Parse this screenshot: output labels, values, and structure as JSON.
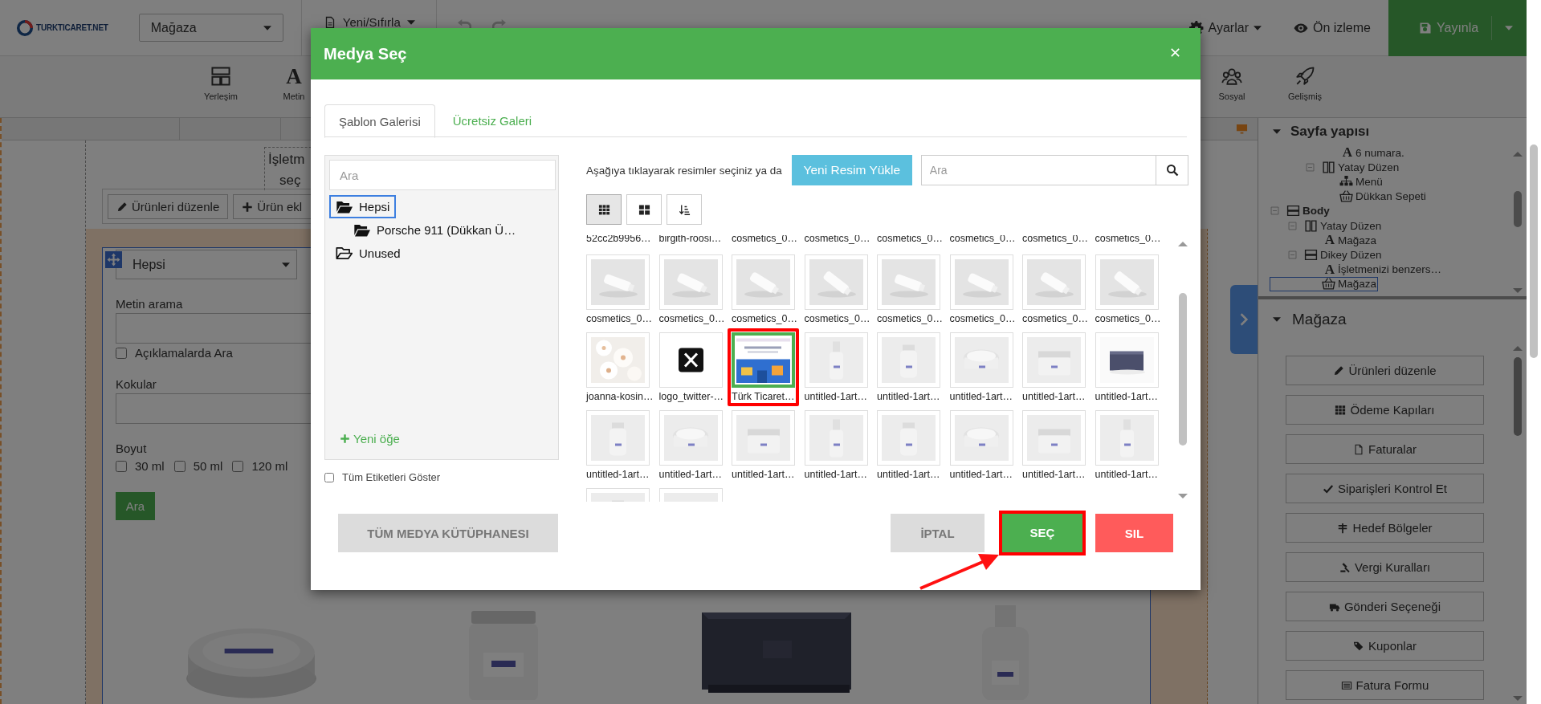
{
  "topbar": {
    "logo_text": "TURKTICARET.NET",
    "page_select": "Mağaza",
    "file_menu": "Yeni/Sıfırla",
    "settings": "Ayarlar",
    "preview": "Ön izleme",
    "publish": "Yayınla"
  },
  "toolbar": {
    "left": [
      {
        "label": "Yerleşim",
        "kind": "layout"
      },
      {
        "label": "Metin",
        "kind": "text",
        "glyph": "A"
      }
    ],
    "right": [
      {
        "label": "Sosyal",
        "kind": "social"
      },
      {
        "label": "Gelişmiş",
        "kind": "advanced"
      }
    ]
  },
  "store_widget": {
    "heading_lines": [
      "İşletm",
      "seç"
    ],
    "actions": [
      {
        "label": "Ürünleri düzenle",
        "kind": "pencil"
      },
      {
        "label": "Ürün ekl",
        "kind": "plus"
      }
    ],
    "category_select": "Hepsi",
    "text_search": {
      "label": "Metin arama",
      "checkbox": {
        "label": "Açıklamalarda Ara",
        "checked": false
      }
    },
    "scents": {
      "label": "Kokular"
    },
    "size": {
      "label": "Boyut",
      "options": [
        {
          "label": "30 ml",
          "checked": false
        },
        {
          "label": "50 ml",
          "checked": false
        },
        {
          "label": "120 ml",
          "checked": false
        }
      ]
    },
    "search_button": "Ara"
  },
  "side_panel": {
    "structure_title": "Sayfa yapısı",
    "tree": [
      {
        "children": [
          {
            "children": [
              {
                "children": [
                  {
                    "kind": "text",
                    "glyph": "A",
                    "label": "6 numara.",
                    "selected": false
                  }
                ]
              },
              {
                "kind": "columns",
                "label": "Yatay Düzen",
                "expanded": true,
                "selected": false,
                "children": [
                  {
                    "kind": "sitemap",
                    "label": "Menü",
                    "selected": false
                  },
                  {
                    "kind": "basket",
                    "label": "Dükkan Sepeti",
                    "selected": false
                  }
                ]
              }
            ]
          }
        ]
      },
      {
        "kind": "section",
        "label": "Body",
        "expanded": true,
        "selected": false,
        "children": [
          {
            "kind": "columns",
            "label": "Yatay Düzen",
            "expanded": true,
            "selected": false,
            "children": [
              {
                "kind": "text",
                "glyph": "A",
                "label": "Mağaza",
                "selected": false
              }
            ]
          },
          {
            "kind": "rows",
            "label": "Dikey Düzen",
            "expanded": true,
            "selected": false,
            "children": [
              {
                "kind": "text",
                "glyph": "A",
                "label": "İşletmenizi benzers…",
                "selected": false
              },
              {
                "kind": "basket",
                "label": "Mağaza",
                "selected": true
              }
            ]
          }
        ]
      }
    ],
    "section_title": "Mağaza",
    "buttons": [
      {
        "label": "Ürünleri düzenle",
        "kind": "pencil"
      },
      {
        "label": "Ödeme Kapıları",
        "kind": "th"
      },
      {
        "label": "Faturalar",
        "kind": "file"
      },
      {
        "label": "Siparişleri Kontrol Et",
        "kind": "check"
      },
      {
        "label": "Hedef Bölgeler",
        "kind": "signpost"
      },
      {
        "label": "Vergi Kuralları",
        "kind": "gavel"
      },
      {
        "label": "Gönderi Seçeneği",
        "kind": "truck"
      },
      {
        "label": "Kuponlar",
        "kind": "tags"
      },
      {
        "label": "Fatura Formu",
        "kind": "listalt"
      }
    ]
  },
  "media_dialog": {
    "title": "Medya Seç",
    "tabs": [
      {
        "label": "Şablon Galerisi",
        "selected": true
      },
      {
        "label": "Ücretsiz Galeri",
        "selected": false
      }
    ],
    "folder_search": {
      "placeholder": "Ara"
    },
    "folders": [
      {
        "label": "Hepsi",
        "selected": true,
        "empty": false,
        "children": [
          {
            "label": "Porsche 911 (Dükkan Ü…",
            "selected": false,
            "empty": false
          }
        ]
      },
      {
        "label": "Unused",
        "selected": false,
        "empty": true
      }
    ],
    "new_item": "Yeni öğe",
    "show_tags": {
      "label": "Tüm Etiketleri Göster",
      "checked": false
    },
    "hint": "Aşağıya tıklayarak resimler seçiniz ya da",
    "upload_button": "Yeni Resim Yükle",
    "search": {
      "placeholder": "Ara"
    },
    "view_buttons": [
      {
        "kind": "small-grid",
        "selected": true
      },
      {
        "kind": "large-grid",
        "selected": false
      },
      {
        "kind": "sort",
        "selected": false
      }
    ],
    "items": [
      {
        "label": "52cc2b9956…",
        "kind": "product",
        "selected": false
      },
      {
        "label": "birgith-roosi…",
        "kind": "product",
        "selected": false
      },
      {
        "label": "cosmetics_0…",
        "kind": "product",
        "selected": false
      },
      {
        "label": "cosmetics_0…",
        "kind": "product",
        "selected": false
      },
      {
        "label": "cosmetics_0…",
        "kind": "product",
        "selected": false
      },
      {
        "label": "cosmetics_0…",
        "kind": "product",
        "selected": false
      },
      {
        "label": "cosmetics_0…",
        "kind": "product",
        "selected": false
      },
      {
        "label": "cosmetics_0…",
        "kind": "product",
        "selected": false
      },
      {
        "label": "cosmetics_0…",
        "kind": "product",
        "selected": false
      },
      {
        "label": "cosmetics_0…",
        "kind": "product",
        "selected": false
      },
      {
        "label": "cosmetics_0…",
        "kind": "product",
        "selected": false
      },
      {
        "label": "cosmetics_0…",
        "kind": "product",
        "selected": false
      },
      {
        "label": "cosmetics_0…",
        "kind": "product",
        "selected": false
      },
      {
        "label": "cosmetics_0…",
        "kind": "product",
        "selected": false
      },
      {
        "label": "cosmetics_0…",
        "kind": "product",
        "selected": false
      },
      {
        "label": "cosmetics_0…",
        "kind": "product",
        "selected": false
      },
      {
        "label": "joanna-kosin…",
        "kind": "flowers",
        "selected": false
      },
      {
        "label": "logo_twitter-…",
        "kind": "logo",
        "selected": false
      },
      {
        "label": "Türk Ticaret…",
        "kind": "screenshot",
        "selected": true
      },
      {
        "label": "untitled-1art…",
        "kind": "mockup",
        "selected": false
      },
      {
        "label": "untitled-1art…",
        "kind": "mockup",
        "selected": false
      },
      {
        "label": "untitled-1art…",
        "kind": "mockup",
        "selected": false
      },
      {
        "label": "untitled-1art…",
        "kind": "mockup",
        "selected": false
      },
      {
        "label": "untitled-1art…",
        "kind": "soap",
        "selected": false
      },
      {
        "label": "untitled-1art…",
        "kind": "mockup",
        "selected": false
      },
      {
        "label": "untitled-1art…",
        "kind": "mockup",
        "selected": false
      },
      {
        "label": "untitled-1art…",
        "kind": "mockup",
        "selected": false
      },
      {
        "label": "untitled-1art…",
        "kind": "mockup",
        "selected": false
      },
      {
        "label": "untitled-1art…",
        "kind": "mockup",
        "selected": false
      },
      {
        "label": "untitled-1art…",
        "kind": "mockup",
        "selected": false
      },
      {
        "label": "untitled-1art…",
        "kind": "mockup",
        "selected": false
      },
      {
        "label": "untitled-1art…",
        "kind": "mockup",
        "selected": false
      },
      {
        "kind": "mockup",
        "selected": false
      },
      {
        "kind": "mockup",
        "selected": false
      }
    ],
    "footer_buttons": [
      {
        "label": "TÜM MEDYA KÜTÜPHANESI",
        "kind": "library",
        "highlighted": false
      },
      {
        "label": "İPTAL",
        "kind": "cancel",
        "highlighted": false
      },
      {
        "label": "SEÇ",
        "kind": "select",
        "highlighted": true
      },
      {
        "label": "SIL",
        "kind": "delete",
        "highlighted": false
      }
    ]
  }
}
